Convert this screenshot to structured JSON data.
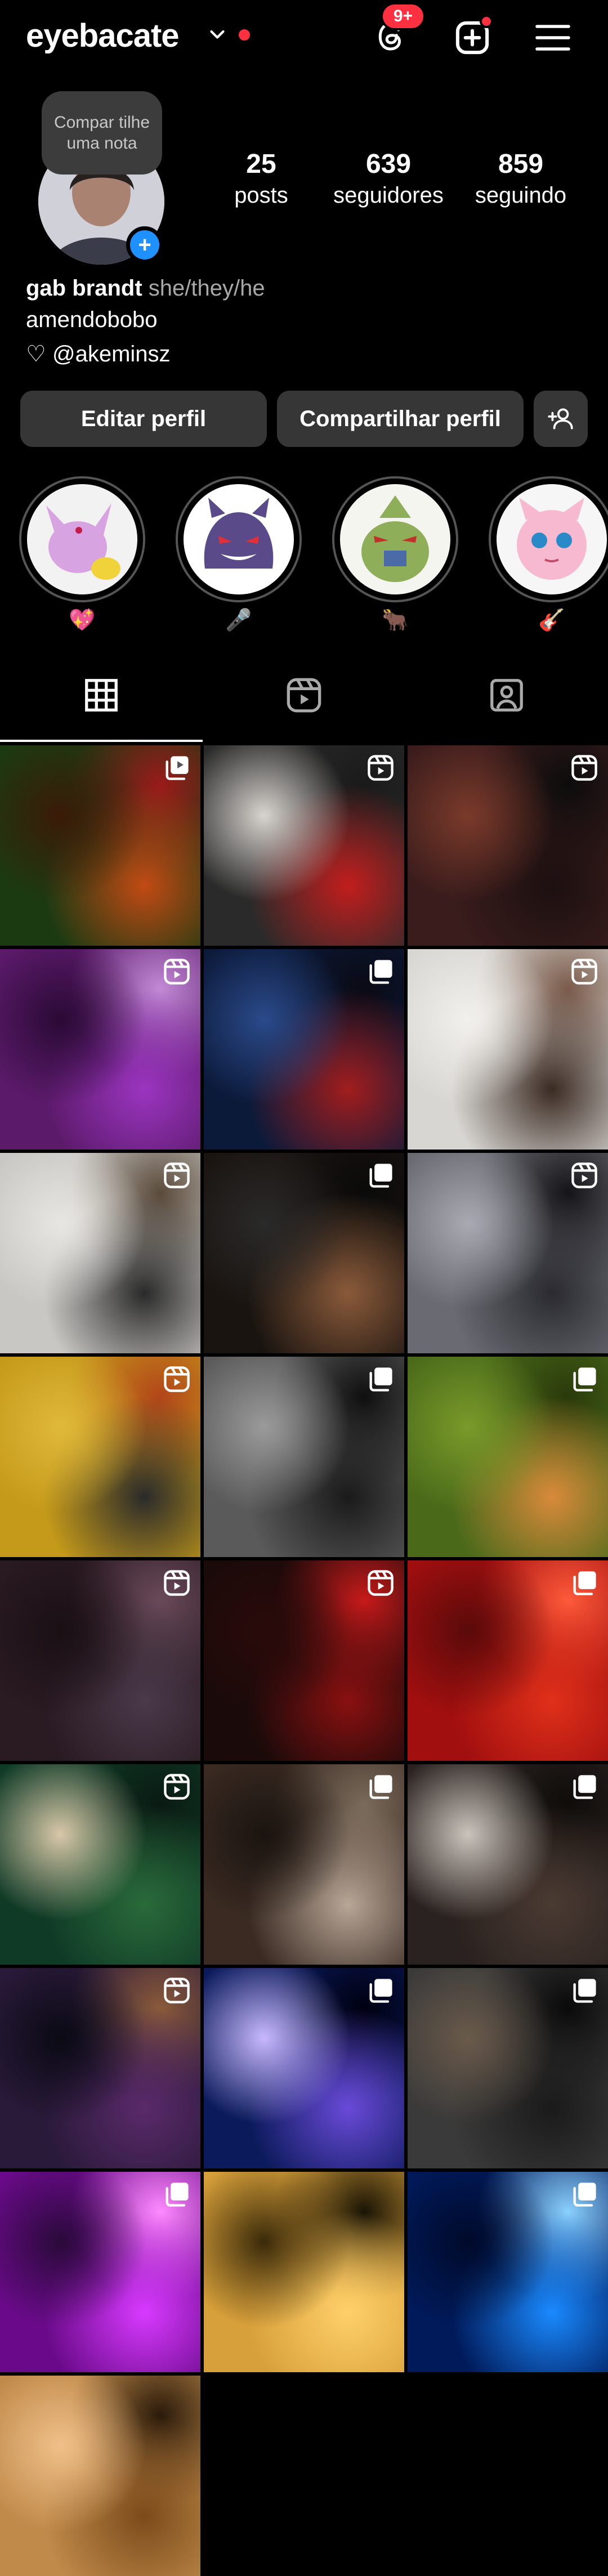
{
  "header": {
    "username": "eyebacate",
    "notification_badge": "9+"
  },
  "profile": {
    "note": "Compar tilhe uma nota",
    "stats": [
      {
        "num": "25",
        "label": "posts"
      },
      {
        "num": "639",
        "label": "seguidores"
      },
      {
        "num": "859",
        "label": "seguindo"
      }
    ],
    "name": "gab brandt",
    "pronouns": "she/they/he",
    "bio": "amendobobo",
    "link": "♡ @akeminsz"
  },
  "buttons": {
    "edit": "Editar perfil",
    "share": "Compartilhar perfil"
  },
  "highlights": [
    {
      "caption": "💖",
      "art": "espeon"
    },
    {
      "caption": "🎤",
      "art": "gengar"
    },
    {
      "caption": "🐂",
      "art": "tyranitar"
    },
    {
      "caption": "🎸",
      "art": "jigglypuff"
    }
  ],
  "tabs": [
    "grid-icon",
    "reels-icon",
    "tagged-icon"
  ],
  "grid": [
    {
      "type": "carousel-reel",
      "colors": [
        "#1c3a12",
        "#c24a14",
        "#3b1a08",
        "#9b1a1a"
      ]
    },
    {
      "type": "reel",
      "colors": [
        "#2a2a2a",
        "#c21d1d",
        "#d8d4cf",
        "#1a1a1a"
      ]
    },
    {
      "type": "reel",
      "colors": [
        "#3a1c1c",
        "#1c1010",
        "#7a3a2a",
        "#0c0c0c"
      ]
    },
    {
      "type": "reel",
      "colors": [
        "#5b1a6a",
        "#9b35c0",
        "#2a0a35",
        "#c28ad6"
      ]
    },
    {
      "type": "carousel",
      "colors": [
        "#0c1a3a",
        "#a11d1d",
        "#2a4a8a",
        "#0a0a14"
      ]
    },
    {
      "type": "reel",
      "colors": [
        "#d8d6d2",
        "#3a2a22",
        "#f2f0ec",
        "#7a5a4a"
      ]
    },
    {
      "type": "reel",
      "colors": [
        "#c9c7c3",
        "#2a2a2a",
        "#e8e6e2",
        "#5a4a3a"
      ]
    },
    {
      "type": "carousel",
      "colors": [
        "#1a1410",
        "#8a5a3a",
        "#2a2a2a",
        "#0a0a0a"
      ]
    },
    {
      "type": "reel",
      "colors": [
        "#6a6a72",
        "#2a2a30",
        "#a9a9b2",
        "#151518"
      ]
    },
    {
      "type": "reel",
      "colors": [
        "#c59a1a",
        "#2a2a2a",
        "#e0b83a",
        "#b2451a"
      ]
    },
    {
      "type": "carousel",
      "colors": [
        "#5a5a5a",
        "#1a1a1a",
        "#9a9a9a",
        "#0f0f0f"
      ]
    },
    {
      "type": "carousel",
      "colors": [
        "#4a6a1a",
        "#d88a3a",
        "#7a9a2a",
        "#2a3a0a"
      ]
    },
    {
      "type": "reel",
      "colors": [
        "#2a1a22",
        "#4a3a4a",
        "#1a1014",
        "#6a4a5a"
      ]
    },
    {
      "type": "reel",
      "colors": [
        "#1a0a0a",
        "#8a1010",
        "#2a0a0a",
        "#c81a1a"
      ]
    },
    {
      "type": "carousel",
      "colors": [
        "#a10f0f",
        "#e0301a",
        "#5a0a0a",
        "#ff5a3a"
      ]
    },
    {
      "type": "reel",
      "colors": [
        "#0f3a26",
        "#2a6a3a",
        "#d8c8a8",
        "#0a1a12"
      ]
    },
    {
      "type": "carousel",
      "colors": [
        "#3a2a22",
        "#b8a696",
        "#1a1410",
        "#7a6a5a"
      ]
    },
    {
      "type": "carousel",
      "colors": [
        "#2a2220",
        "#4a3a32",
        "#cac4bc",
        "#0f0c0a"
      ]
    },
    {
      "type": "reel",
      "colors": [
        "#2a1a3a",
        "#5a2a6a",
        "#0a0a14",
        "#8a5a3a"
      ]
    },
    {
      "type": "carousel",
      "colors": [
        "#0a1a5a",
        "#6a4ad8",
        "#c8b8ff",
        "#000010"
      ]
    },
    {
      "type": "carousel",
      "colors": [
        "#3a3a3a",
        "#1a1a1a",
        "#6a5a4a",
        "#0a0a0a"
      ]
    },
    {
      "type": "carousel",
      "colors": [
        "#6a0a8a",
        "#d83aff",
        "#2a0a3a",
        "#ff8aff"
      ]
    },
    {
      "type": "none",
      "colors": [
        "#d8a03a",
        "#ffd06a",
        "#3a2a0a",
        "#1a1405"
      ]
    },
    {
      "type": "carousel",
      "colors": [
        "#001a5a",
        "#1a8aff",
        "#000a2a",
        "#8ad0ff"
      ]
    },
    {
      "type": "none",
      "colors": [
        "#c08a4a",
        "#7a4a1a",
        "#f0c08a",
        "#2a1a0a"
      ]
    }
  ]
}
